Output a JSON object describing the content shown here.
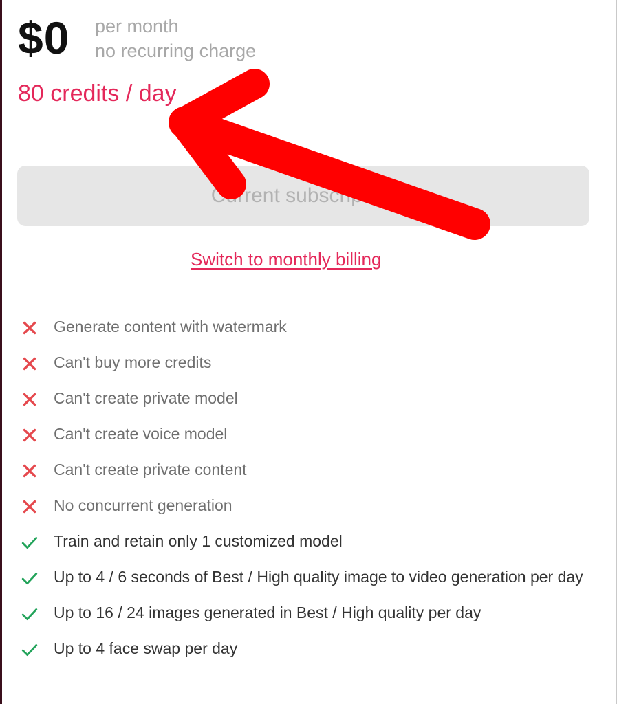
{
  "plan": {
    "price": "$0",
    "period_line1": "per month",
    "period_line2": "no recurring charge",
    "credits": "80 credits / day",
    "current_button_label": "Current subscription",
    "switch_link": "Switch to monthly billing"
  },
  "features": [
    {
      "text": "Generate content with watermark",
      "included": false,
      "icon": "x-icon"
    },
    {
      "text": "Can't buy more credits",
      "included": false,
      "icon": "x-icon"
    },
    {
      "text": "Can't create private model",
      "included": false,
      "icon": "x-icon"
    },
    {
      "text": "Can't create voice model",
      "included": false,
      "icon": "x-icon"
    },
    {
      "text": "Can't create private content",
      "included": false,
      "icon": "x-icon"
    },
    {
      "text": "No concurrent generation",
      "included": false,
      "icon": "x-icon"
    },
    {
      "text": "Train and retain only 1 customized model",
      "included": true,
      "icon": "check-icon"
    },
    {
      "text": "Up to 4 / 6 seconds of Best / High quality image to video generation per day",
      "included": true,
      "icon": "check-icon"
    },
    {
      "text": "Up to 16 / 24 images generated in Best / High quality per day",
      "included": true,
      "icon": "check-icon"
    },
    {
      "text": "Up to 4 face swap per day",
      "included": true,
      "icon": "check-icon"
    }
  ],
  "colors": {
    "accent": "#e4285a",
    "negative_icon": "#e5484d",
    "positive_icon": "#22a35a",
    "annotation_arrow": "#ff0000"
  },
  "annotation": {
    "icon": "red-arrow-annotation"
  }
}
